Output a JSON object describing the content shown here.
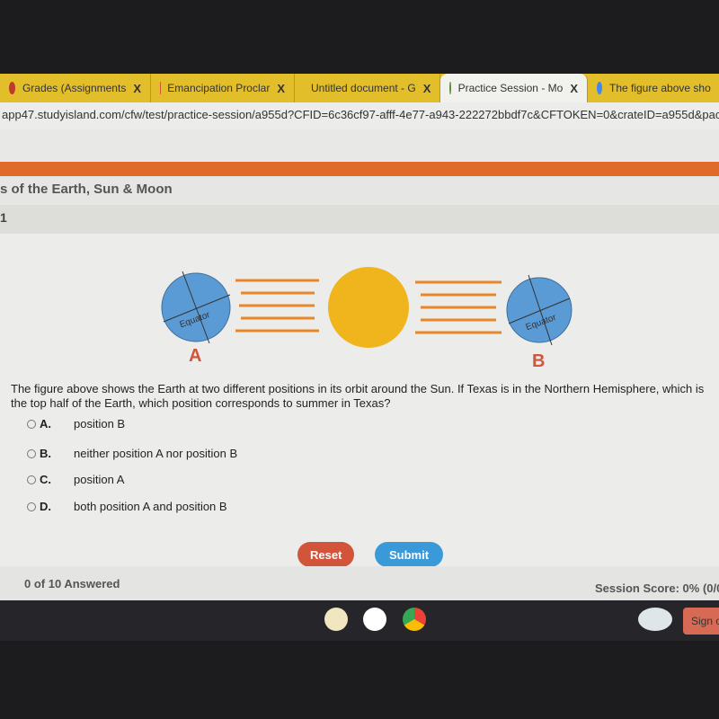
{
  "browser": {
    "tabs": [
      {
        "label": "Grades (Assignments",
        "icon": "pin-icon",
        "color": "#c0392b"
      },
      {
        "label": "Emancipation Proclar",
        "icon": "slides-icon",
        "color": "#d9532c"
      },
      {
        "label": "Untitled document - G",
        "icon": "docs-icon",
        "color": "#4a7fd6"
      },
      {
        "label": "Practice Session - Mo",
        "icon": "studyisland-icon",
        "color": "#5a8f3a",
        "active": true
      },
      {
        "label": "The figure above sho",
        "icon": "google-icon",
        "color": "#4285f4"
      }
    ],
    "close": "X",
    "url": "app47.studyisland.com/cfw/test/practice-session/a955d?CFID=6c36cf97-afff-4e77-a943-222272bbdf7c&CFTOKEN=0&crateID=a955d&packID="
  },
  "header": {
    "title": "s of the Earth, Sun & Moon",
    "question_number": "1"
  },
  "figure": {
    "label_a": "A",
    "label_b": "B",
    "equator": "Equator",
    "colors": {
      "sun": "#f0b41c",
      "earth": "#5b9bd5",
      "arrows": "#e8862a"
    }
  },
  "question": {
    "text": "The figure above shows the Earth at two different positions in its orbit around the Sun. If Texas is in the Northern Hemisphere, which is the top half of the Earth, which position corresponds to summer in Texas?",
    "options": [
      {
        "letter": "A.",
        "text": "position B"
      },
      {
        "letter": "B.",
        "text": "neither position A nor position B"
      },
      {
        "letter": "C.",
        "text": "position A"
      },
      {
        "letter": "D.",
        "text": "both position A and position B"
      }
    ]
  },
  "buttons": {
    "reset": "Reset",
    "submit": "Submit",
    "reset_color": "#d2543a",
    "submit_color": "#3a9ad9"
  },
  "footer": {
    "answered": "0 of 10 Answered",
    "score": "Session Score: 0% (0/0"
  },
  "shelf": {
    "sign_out": "Sign o"
  }
}
